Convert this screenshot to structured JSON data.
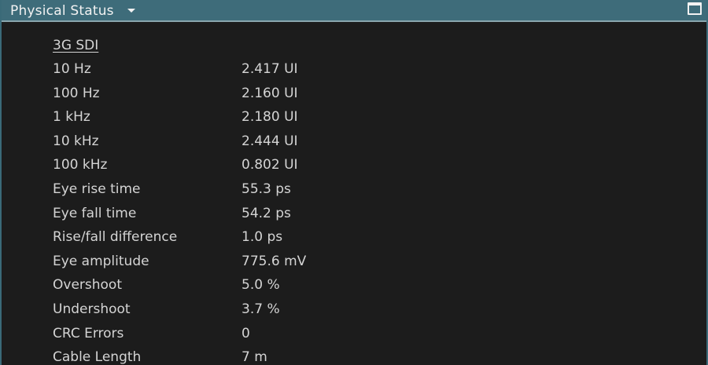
{
  "panel": {
    "title": "Physical Status",
    "dropdown_icon": "triangle-down",
    "maximize_icon": "window-maximize"
  },
  "section": {
    "header": "3G SDI"
  },
  "rows": [
    {
      "label": "10 Hz",
      "value": "2.417 UI"
    },
    {
      "label": "100 Hz",
      "value": "2.160 UI"
    },
    {
      "label": "1 kHz",
      "value": "2.180 UI"
    },
    {
      "label": "10 kHz",
      "value": "2.444 UI"
    },
    {
      "label": "100 kHz",
      "value": "0.802 UI"
    },
    {
      "label": "Eye rise time",
      "value": "55.3 ps"
    },
    {
      "label": "Eye fall time",
      "value": "54.2 ps"
    },
    {
      "label": "Rise/fall difference",
      "value": "1.0 ps"
    },
    {
      "label": "Eye amplitude",
      "value": "775.6 mV"
    },
    {
      "label": "Overshoot",
      "value": "5.0 %"
    },
    {
      "label": "Undershoot",
      "value": "3.7 %"
    },
    {
      "label": "CRC Errors",
      "value": "0"
    },
    {
      "label": "Cable Length",
      "value": "7 m"
    }
  ],
  "colors": {
    "titlebar": "#3e6c7a",
    "background": "#1c1c1c",
    "text": "#d4d4d4"
  }
}
